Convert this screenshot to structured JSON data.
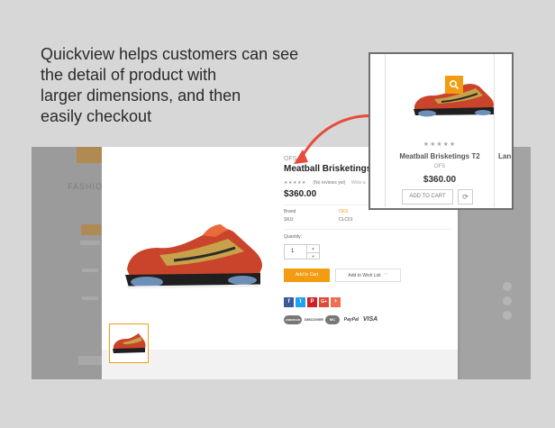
{
  "caption": {
    "line1": "Quickview helps customers can see",
    "line2": "the detail of product with",
    "line3": "larger dimensions, and then",
    "line4": "easily checkout"
  },
  "background": {
    "store_label": "FASHION"
  },
  "quickview": {
    "brand": "OFS",
    "title": "Meatball Brisketings T2",
    "stars": "★★★★★",
    "reviews": "(No reviews yet)",
    "write_review": "Write a",
    "price": "$360.00",
    "brand_label": "Brand",
    "brand_value": "OFS",
    "sku_label": "SKU:",
    "sku_value": "CLC01",
    "quantity_label": "Quantity:",
    "quantity_value": "1",
    "add_to_cart": "Add to Cart",
    "wishlist": "Add to Wish List",
    "share": [
      "f",
      "t",
      "P",
      "G+",
      "+"
    ],
    "share_colors": [
      "#3b5998",
      "#1da1f2",
      "#cb2027",
      "#dd4b39",
      "#f26d4f"
    ],
    "payments": [
      "AMERICAN",
      "DISCOVER",
      "MC",
      "PayPal",
      "VISA"
    ]
  },
  "product_card": {
    "stars": "★★★★★",
    "title": "Meatball Brisketings T2",
    "brand": "OFS",
    "price": "$360.00",
    "add_to_cart": "ADD TO CART",
    "next_title": "Lan"
  },
  "colors": {
    "accent": "#f39c12",
    "arrow": "#e74c3c"
  }
}
